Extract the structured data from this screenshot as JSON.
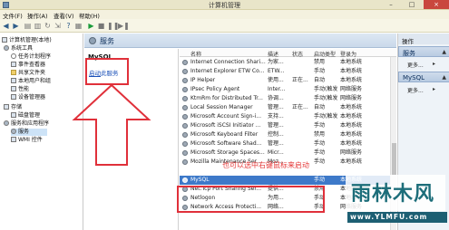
{
  "window": {
    "title": "计算机管理",
    "min_label": "–",
    "max_label": "□",
    "close_label": "×"
  },
  "menubar": {
    "items": [
      "文件(F)",
      "操作(A)",
      "查看(V)",
      "帮助(H)"
    ]
  },
  "toolbar": {
    "icons": [
      "back-arrow-icon",
      "forward-arrow-icon",
      "up-folder-icon",
      "show-hide-tree-icon",
      "refresh-icon",
      "export-icon",
      "help-icon",
      "properties-icon",
      "start-icon",
      "stop-icon",
      "pause-icon",
      "restart-icon"
    ]
  },
  "tree": {
    "items": [
      {
        "label": "计算机管理(本地)",
        "icon": "computer-icon"
      },
      {
        "label": "系统工具",
        "icon": "tools-icon"
      },
      {
        "label": "任务计划程序",
        "icon": "task-scheduler-icon"
      },
      {
        "label": "事件查看器",
        "icon": "event-viewer-icon"
      },
      {
        "label": "共享文件夹",
        "icon": "shared-folder-icon"
      },
      {
        "label": "本地用户和组",
        "icon": "users-icon"
      },
      {
        "label": "性能",
        "icon": "performance-icon"
      },
      {
        "label": "设备管理器",
        "icon": "device-manager-icon"
      },
      {
        "label": "存储",
        "icon": "storage-icon"
      },
      {
        "label": "磁盘管理",
        "icon": "disk-icon"
      },
      {
        "label": "服务和应用程序",
        "icon": "services-apps-icon"
      },
      {
        "label": "服务",
        "icon": "services-icon"
      },
      {
        "label": "WMI 控件",
        "icon": "wmi-icon"
      }
    ]
  },
  "services_panel": {
    "header": "服务",
    "selected_service": "MySQL",
    "start_link_prefix": "启动",
    "start_link_suffix": "此服务",
    "columns": {
      "name": "名称",
      "desc": "描述",
      "state": "状态",
      "startup": "启动类型",
      "logon": "登录为"
    },
    "rows": [
      {
        "name": "Internet Connection Shari...",
        "desc": "为家...",
        "state": "",
        "startup": "禁用",
        "logon": "本地系统"
      },
      {
        "name": "Internet Explorer ETW Co...",
        "desc": "ETW...",
        "state": "",
        "startup": "手动",
        "logon": "本地系统"
      },
      {
        "name": "IP Helper",
        "desc": "使用...",
        "state": "正在...",
        "startup": "自动",
        "logon": "本地系统"
      },
      {
        "name": "IPsec Policy Agent",
        "desc": "Inter...",
        "state": "",
        "startup": "手动(触发...",
        "logon": "网络服务"
      },
      {
        "name": "KtmRm for Distributed Tr...",
        "desc": "协调...",
        "state": "",
        "startup": "手动(触发...",
        "logon": "网络服务"
      },
      {
        "name": "Local Session Manager",
        "desc": "管理...",
        "state": "正在...",
        "startup": "自动",
        "logon": "本地系统"
      },
      {
        "name": "Microsoft Account Sign-i...",
        "desc": "支持...",
        "state": "",
        "startup": "手动(触发...",
        "logon": "本地系统"
      },
      {
        "name": "Microsoft iSCSI Initiator ...",
        "desc": "管理...",
        "state": "",
        "startup": "手动",
        "logon": "本地系统"
      },
      {
        "name": "Microsoft Keyboard Filter",
        "desc": "控制...",
        "state": "",
        "startup": "禁用",
        "logon": "本地系统"
      },
      {
        "name": "Microsoft Software Shad...",
        "desc": "管理...",
        "state": "",
        "startup": "手动",
        "logon": "本地系统"
      },
      {
        "name": "Microsoft Storage Spaces...",
        "desc": "Micr...",
        "state": "",
        "startup": "手动",
        "logon": "网络服务"
      },
      {
        "name": "Mozilla Maintenance Ser...",
        "desc": "Moz...",
        "state": "",
        "startup": "手动",
        "logon": "本地系统"
      },
      {
        "name": "",
        "desc": "",
        "state": "",
        "startup": "",
        "logon": ""
      },
      {
        "name": "MySQL",
        "desc": "",
        "state": "",
        "startup": "手动",
        "logon": "本地系统"
      },
      {
        "name": "Net.Tcp Port Sharing Ser...",
        "desc": "提供...",
        "state": "",
        "startup": "禁用",
        "logon": "本地服务"
      },
      {
        "name": "Netlogon",
        "desc": "为用...",
        "state": "",
        "startup": "手动",
        "logon": "本地系统"
      },
      {
        "name": "Network Access Protecti...",
        "desc": "网络...",
        "state": "",
        "startup": "手动",
        "logon": "网络服务"
      }
    ]
  },
  "actions_panel": {
    "header": "操作",
    "section1": "服务",
    "section1_more": "更多...",
    "section2": "MySQL",
    "section2_more": "更多...",
    "arrow": "▲"
  },
  "annotation": {
    "text": "也可以选中右键鼠标来启动"
  },
  "watermark": {
    "logo": "雨林木风",
    "url": "www.YLMFU.com"
  },
  "colors": {
    "highlight": "#e0303a",
    "selection": "#3d79c9",
    "link": "#1a50b8"
  }
}
